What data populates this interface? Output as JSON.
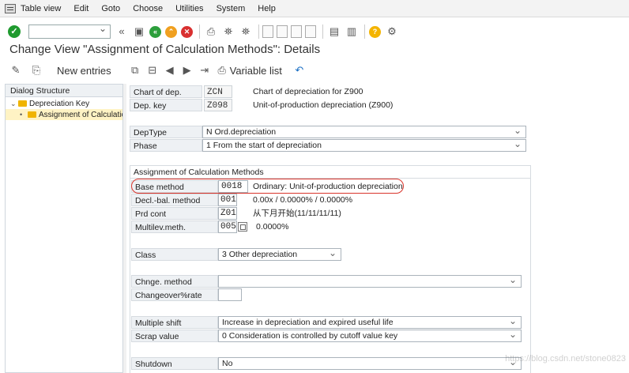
{
  "menu": [
    "Table view",
    "Edit",
    "Goto",
    "Choose",
    "Utilities",
    "System",
    "Help"
  ],
  "title": "Change View \"Assignment of Calculation Methods\": Details",
  "app_toolbar": {
    "new_entries": "New entries",
    "variable_list": "Variable list"
  },
  "dialog": {
    "header": "Dialog Structure",
    "items": [
      "Depreciation Key",
      "Assignment of Calculatio"
    ]
  },
  "header_fields": {
    "chart_label": "Chart of dep.",
    "chart_value": "ZCN",
    "chart_desc": "Chart of depreciation for Z900",
    "depkey_label": "Dep. key",
    "depkey_value": "Z098",
    "depkey_desc": "Unit-of-production depreciation (Z900)"
  },
  "deptype": {
    "label": "DepType",
    "value": "N Ord.depreciation"
  },
  "phase": {
    "label": "Phase",
    "value": "1 From the start of depreciation"
  },
  "assignment": {
    "title": "Assignment of Calculation Methods",
    "base_label": "Base method",
    "base_value": "0018",
    "base_desc": "Ordinary: Unit-of-production depreciation",
    "decl_label": "Decl.-bal. method",
    "decl_value": "001",
    "decl_desc": "0.00x / 0.0000% / 0.0000%",
    "prd_label": "Prd cont",
    "prd_value": "Z01",
    "prd_desc": "从下月开始(11/11/11/11)",
    "multi_label": "Multilev.meth.",
    "multi_value": "005",
    "multi_desc": "0.0000%",
    "class_label": "Class",
    "class_value": "3 Other depreciation",
    "chnge_label": "Chnge. method",
    "chnge_value": "",
    "changeover_label": "Changeover%rate",
    "changeover_value": "",
    "multishift_label": "Multiple shift",
    "multishift_value": "Increase in depreciation and expired useful life",
    "scrap_label": "Scrap value",
    "scrap_value": "0 Consideration is controlled by cutoff value key",
    "shutdown_label": "Shutdown",
    "shutdown_value": "No"
  },
  "watermark": "https://blog.csdn.net/stone0823"
}
